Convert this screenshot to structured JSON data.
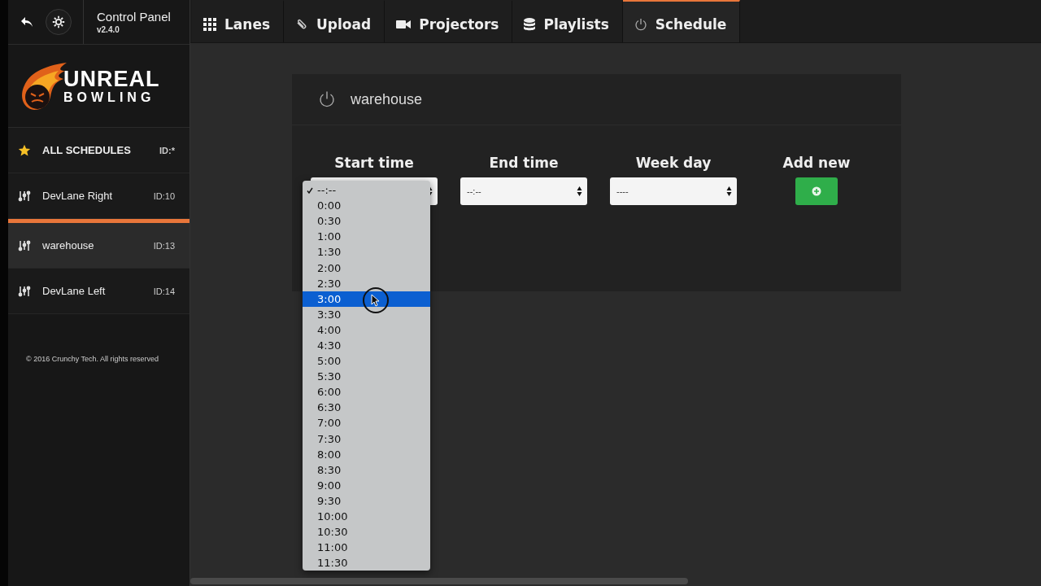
{
  "header": {
    "title": "Control Panel",
    "version": "v2.4.0"
  },
  "logo": {
    "line_1": "UNREAL",
    "line_2": "BOWLING"
  },
  "tabs": [
    {
      "label": "Lanes",
      "selected": false
    },
    {
      "label": "Upload",
      "selected": false
    },
    {
      "label": "Projectors",
      "selected": false
    },
    {
      "label": "Playlists",
      "selected": false
    },
    {
      "label": "Schedule",
      "selected": true
    }
  ],
  "sidebar": {
    "items": [
      {
        "kind": "all",
        "label": "ALL SCHEDULES",
        "id": "ID:*",
        "selected": false
      },
      {
        "kind": "lane",
        "label": "DevLane Right",
        "id": "ID:10",
        "selected": false
      },
      {
        "kind": "lane",
        "label": "warehouse",
        "id": "ID:13",
        "selected": true
      },
      {
        "kind": "lane",
        "label": "DevLane Left",
        "id": "ID:14",
        "selected": false
      }
    ],
    "footer": "© 2016 Crunchy Tech. All rights reserved"
  },
  "panel": {
    "title": "warehouse",
    "start_time": {
      "label": "Start time"
    },
    "end_time": {
      "label": "End time",
      "value": "--:--"
    },
    "week_day": {
      "label": "Week day",
      "value": "----"
    },
    "add_new": {
      "label": "Add new"
    }
  },
  "dropdown": {
    "options": [
      {
        "label": "--:--",
        "checked": true,
        "selected": false
      },
      {
        "label": "0:00",
        "checked": false,
        "selected": false
      },
      {
        "label": "0:30",
        "checked": false,
        "selected": false
      },
      {
        "label": "1:00",
        "checked": false,
        "selected": false
      },
      {
        "label": "1:30",
        "checked": false,
        "selected": false
      },
      {
        "label": "2:00",
        "checked": false,
        "selected": false
      },
      {
        "label": "2:30",
        "checked": false,
        "selected": false
      },
      {
        "label": "3:00",
        "checked": false,
        "selected": true
      },
      {
        "label": "3:30",
        "checked": false,
        "selected": false
      },
      {
        "label": "4:00",
        "checked": false,
        "selected": false
      },
      {
        "label": "4:30",
        "checked": false,
        "selected": false
      },
      {
        "label": "5:00",
        "checked": false,
        "selected": false
      },
      {
        "label": "5:30",
        "checked": false,
        "selected": false
      },
      {
        "label": "6:00",
        "checked": false,
        "selected": false
      },
      {
        "label": "6:30",
        "checked": false,
        "selected": false
      },
      {
        "label": "7:00",
        "checked": false,
        "selected": false
      },
      {
        "label": "7:30",
        "checked": false,
        "selected": false
      },
      {
        "label": "8:00",
        "checked": false,
        "selected": false
      },
      {
        "label": "8:30",
        "checked": false,
        "selected": false
      },
      {
        "label": "9:00",
        "checked": false,
        "selected": false
      },
      {
        "label": "9:30",
        "checked": false,
        "selected": false
      },
      {
        "label": "10:00",
        "checked": false,
        "selected": false
      },
      {
        "label": "10:30",
        "checked": false,
        "selected": false
      },
      {
        "label": "11:00",
        "checked": false,
        "selected": false
      },
      {
        "label": "11:30",
        "checked": false,
        "selected": false
      }
    ]
  }
}
